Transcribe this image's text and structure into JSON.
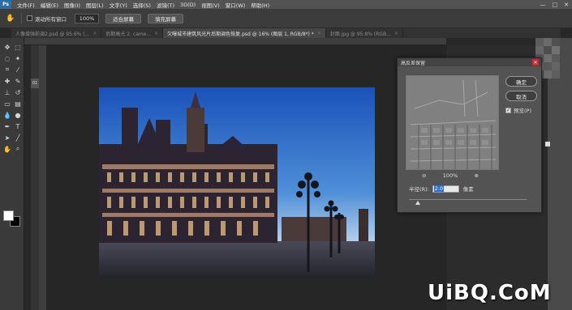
{
  "menubar": {
    "logo": "Ps",
    "items": [
      "文件(F)",
      "编辑(E)",
      "图像(I)",
      "图层(L)",
      "文字(Y)",
      "选择(S)",
      "滤镜(T)",
      "3D(D)",
      "视图(V)",
      "窗口(W)",
      "帮助(H)"
    ],
    "window_controls": [
      "—",
      "□",
      "✕"
    ]
  },
  "options_bar": {
    "scroll_all_label": "滚动所有窗口",
    "zoom_value": "100%",
    "fit_screen_label": "适合屏幕",
    "fill_screen_label": "填充屏幕"
  },
  "tabs": [
    {
      "label": "人像增强前调2.psd @ 95.6% (...",
      "close": "×",
      "active": false
    },
    {
      "label": "后期高光 2. came...",
      "close": "×",
      "active": false
    },
    {
      "label": "欠曝城市建筑风光片后期调色恢复.psd @ 16% (图层 1, RGB/8*) *",
      "close": "×",
      "active": true
    },
    {
      "label": "封面.jpg @ 95.8% (RGB...",
      "close": "×",
      "active": false
    }
  ],
  "dialog": {
    "title": "高反差保留",
    "close_icon": "✕",
    "ok_label": "确定",
    "cancel_label": "取消",
    "preview_label": "预览(P)",
    "preview_checked": true,
    "zoom_out_icon": "⊖",
    "zoom_in_icon": "⊕",
    "zoom_value": "100%",
    "radius_label": "半径(R):",
    "radius_value": "2.0",
    "radius_unit": "像素",
    "slider_fraction": 0.06
  },
  "left_panel_label": "01",
  "watermark": "UiBQ.CoM",
  "colors": {
    "menubar_bg": "#535353",
    "accent": "#2b6fd6",
    "foreground_swatch": "#ffffff",
    "background_swatch": "#000000"
  }
}
